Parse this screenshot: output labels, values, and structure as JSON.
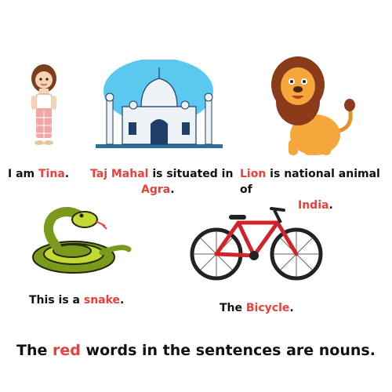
{
  "colors": {
    "noun_red": "#e8403a",
    "text": "#111111",
    "sky": "#5bc8f0"
  },
  "captions": {
    "tina": {
      "before": "I am ",
      "noun": "Tina",
      "after": "."
    },
    "taj": {
      "noun": "Taj Mahal",
      "middle": " is situated in",
      "noun2": "Agra",
      "after": "."
    },
    "lion": {
      "noun": "Lion",
      "middle": " is national animal of",
      "noun2": "India",
      "after": "."
    },
    "snake": {
      "before": "This is a ",
      "noun": "snake",
      "after": "."
    },
    "bicycle": {
      "before": "The ",
      "noun": "Bicycle",
      "after": "."
    }
  },
  "footer": {
    "before": "The ",
    "noun": "red",
    "after": " words in the sentences are nouns."
  },
  "icons": [
    "girl-illustration",
    "taj-mahal-illustration",
    "lion-illustration",
    "snake-illustration",
    "bicycle-illustration"
  ]
}
